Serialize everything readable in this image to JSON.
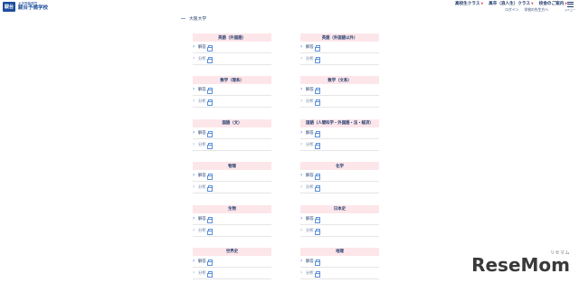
{
  "logo": {
    "mark": "駿台",
    "sub": "大学受験専門",
    "main": "駿台予備学校"
  },
  "nav": {
    "items": [
      "高校生クラス",
      "高卒（浪人生）クラス",
      "校舎のご案内"
    ],
    "sub_items": [
      "ログイン",
      "学校の先生方へ"
    ],
    "menu_label": "メニュー"
  },
  "breadcrumb": "大阪大学",
  "cards": [
    [
      {
        "title": "英語（外国語）",
        "answer": "解答",
        "analysis": "分析"
      },
      {
        "title": "英語（外国語以外）",
        "answer": "解答",
        "analysis": "分析"
      }
    ],
    [
      {
        "title": "数学（理系）",
        "answer": "解答",
        "analysis": "分析"
      },
      {
        "title": "数学（文系）",
        "answer": "解答",
        "analysis": "分析"
      }
    ],
    [
      {
        "title": "国語（文）",
        "answer": "解答",
        "analysis": "分析"
      },
      {
        "title": "国語（人間科学・外国語・法・経済）",
        "answer": "解答",
        "analysis": "分析"
      }
    ],
    [
      {
        "title": "物理",
        "answer": "解答",
        "analysis": "分析"
      },
      {
        "title": "化学",
        "answer": "解答",
        "analysis": "分析"
      }
    ],
    [
      {
        "title": "生物",
        "answer": "解答",
        "analysis": "分析"
      },
      {
        "title": "日本史",
        "answer": "解答",
        "analysis": "分析"
      }
    ],
    [
      {
        "title": "世界史",
        "answer": "解答",
        "analysis": "分析"
      },
      {
        "title": "地理",
        "answer": "解答",
        "analysis": "分析"
      }
    ]
  ],
  "watermark": {
    "sub": "リセマム",
    "main": "ReseMom"
  },
  "colors": {
    "card_header_bg": "#fde6ea",
    "text_navy": "#1f3a6b",
    "link_chevron": "#2f6fd0"
  }
}
